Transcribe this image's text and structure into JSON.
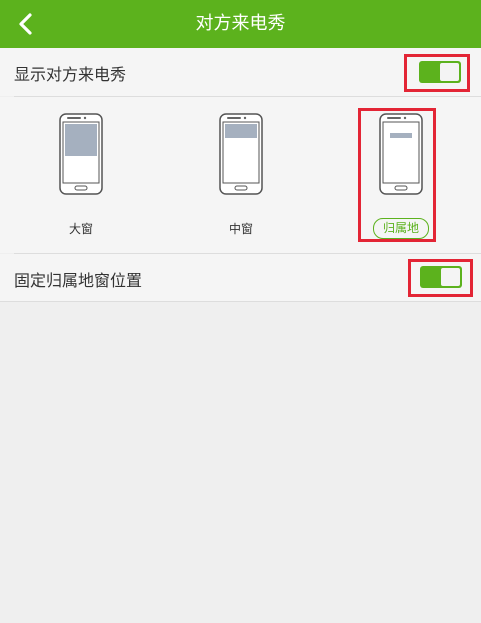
{
  "header": {
    "title": "对方来电秀"
  },
  "settings": {
    "show_caller_show": {
      "label": "显示对方来电秀",
      "enabled": true
    },
    "fixed_location_window": {
      "label": "固定归属地窗位置",
      "enabled": true
    }
  },
  "display_modes": [
    {
      "label": "大窗",
      "selected": false
    },
    {
      "label": "中窗",
      "selected": false
    },
    {
      "label": "归属地",
      "selected": true
    }
  ],
  "colors": {
    "accent": "#5cb21d",
    "highlight": "#e32535",
    "preview_fill": "#a5b0bf"
  },
  "icons": {
    "back": "chevron-left-icon"
  }
}
